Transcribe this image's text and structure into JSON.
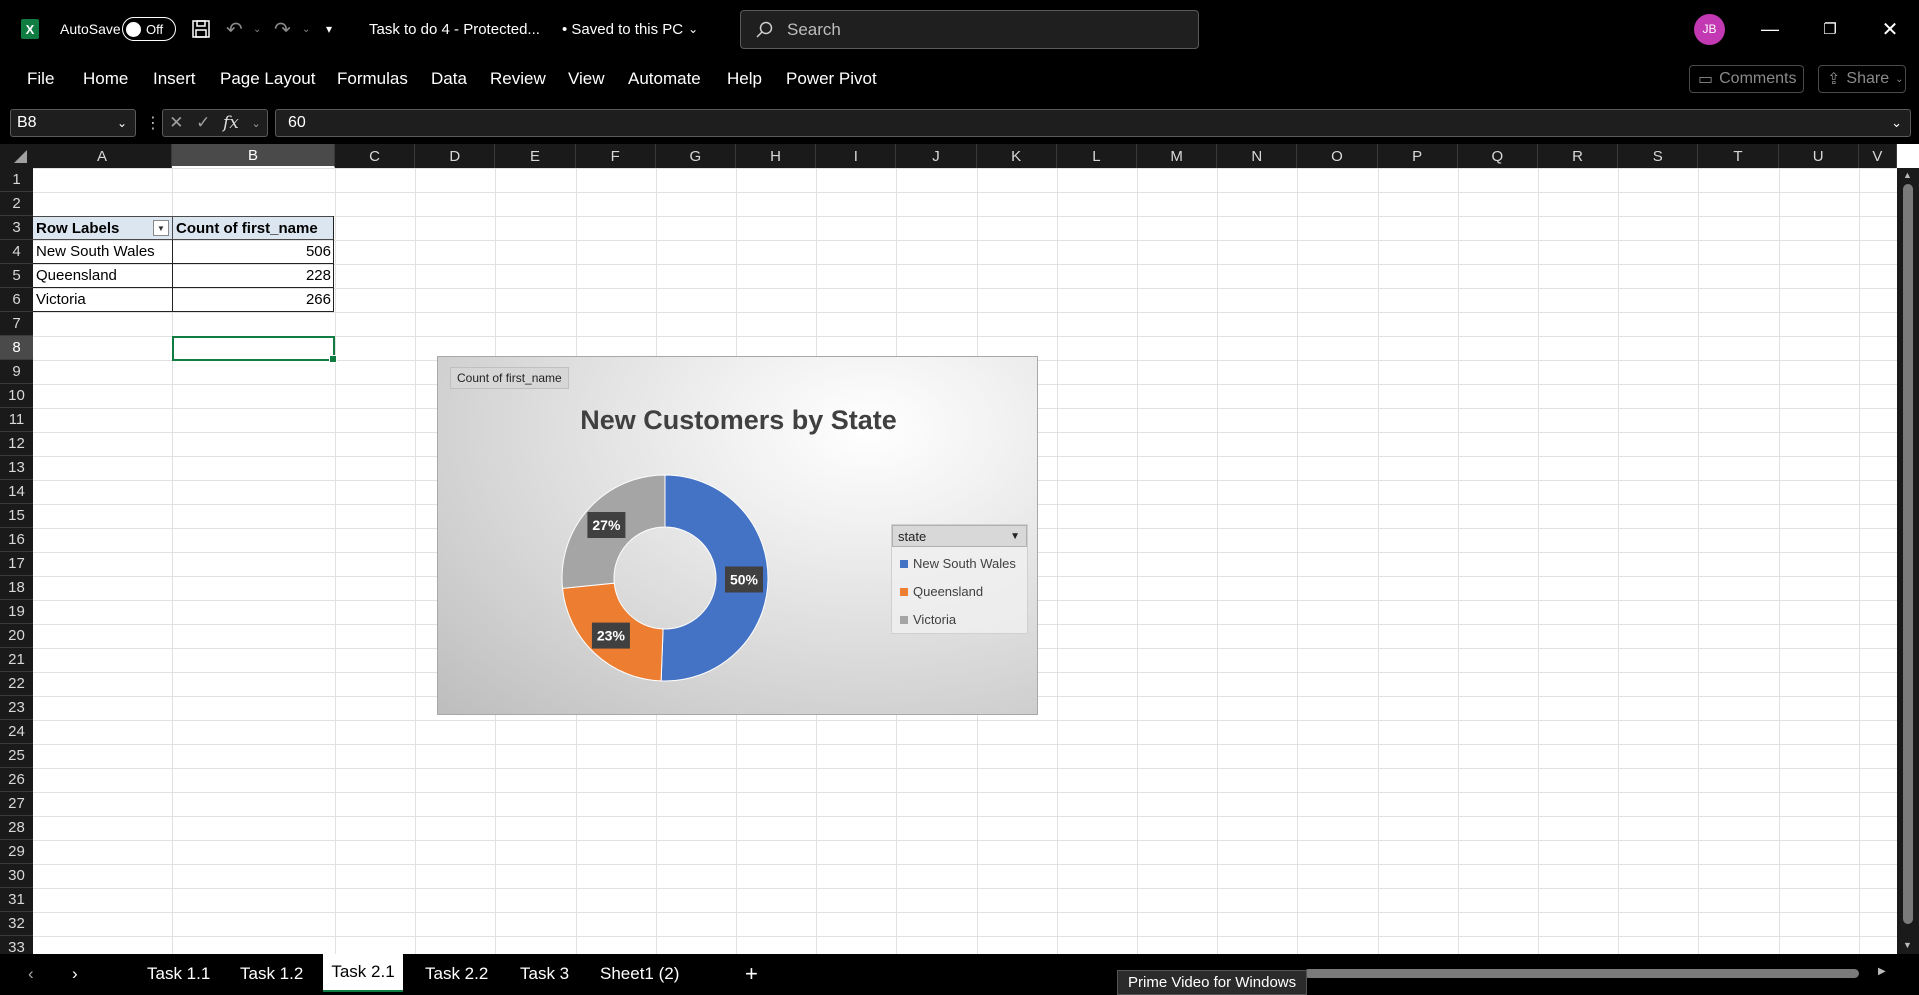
{
  "titlebar": {
    "autosave_label": "AutoSave",
    "autosave_state": "Off",
    "doc_title": "Task to do 4  -  Protected...",
    "save_status": "• Saved to this PC",
    "search_placeholder": "Search",
    "avatar_initials": "JB"
  },
  "menu": {
    "items": [
      "File",
      "Home",
      "Insert",
      "Page Layout",
      "Formulas",
      "Data",
      "Review",
      "View",
      "Automate",
      "Help",
      "Power Pivot"
    ],
    "comments_label": "Comments",
    "share_label": "Share"
  },
  "formula_bar": {
    "name_box": "B8",
    "fx_label": "fx",
    "formula_value": "60"
  },
  "columns": [
    "A",
    "B",
    "C",
    "D",
    "E",
    "F",
    "G",
    "H",
    "I",
    "J",
    "K",
    "L",
    "M",
    "N",
    "O",
    "P",
    "Q",
    "R",
    "S",
    "T",
    "U",
    "V"
  ],
  "rows": [
    "1",
    "2",
    "3",
    "4",
    "5",
    "6",
    "7",
    "8",
    "9",
    "10",
    "11",
    "12",
    "13",
    "14",
    "15",
    "16",
    "17",
    "18",
    "19",
    "20",
    "21",
    "22",
    "23",
    "24",
    "25",
    "26",
    "27",
    "28",
    "29",
    "30",
    "31",
    "32",
    "33"
  ],
  "pivot": {
    "header_row_labels": "Row Labels",
    "header_count": "Count of first_name",
    "rows": [
      {
        "label": "New South Wales",
        "count": "506"
      },
      {
        "label": "Queensland",
        "count": "228"
      },
      {
        "label": "Victoria",
        "count": "266"
      }
    ]
  },
  "chart_data": {
    "type": "pie",
    "variant": "doughnut",
    "title": "New Customers by State",
    "field_button": "Count  of first_name",
    "legend_title": "state",
    "legend_position": "right",
    "categories": [
      "New South Wales",
      "Queensland",
      "Victoria"
    ],
    "values": [
      506,
      228,
      266
    ],
    "labels": [
      "50%",
      "23%",
      "27%"
    ],
    "colors": [
      "#4472c4",
      "#ed7d31",
      "#a5a5a5"
    ]
  },
  "sheet_tabs": {
    "tabs": [
      "Task 1.1",
      "Task 1.2",
      "Task 2.1",
      "Task 2.2",
      "Task 3",
      "Sheet1 (2)"
    ],
    "active": "Task 2.1",
    "add_label": "+"
  },
  "tooltip": "Prime Video for Windows",
  "colors": {
    "accent_green": "#107c41",
    "pivot_header": "#dce6f1"
  }
}
